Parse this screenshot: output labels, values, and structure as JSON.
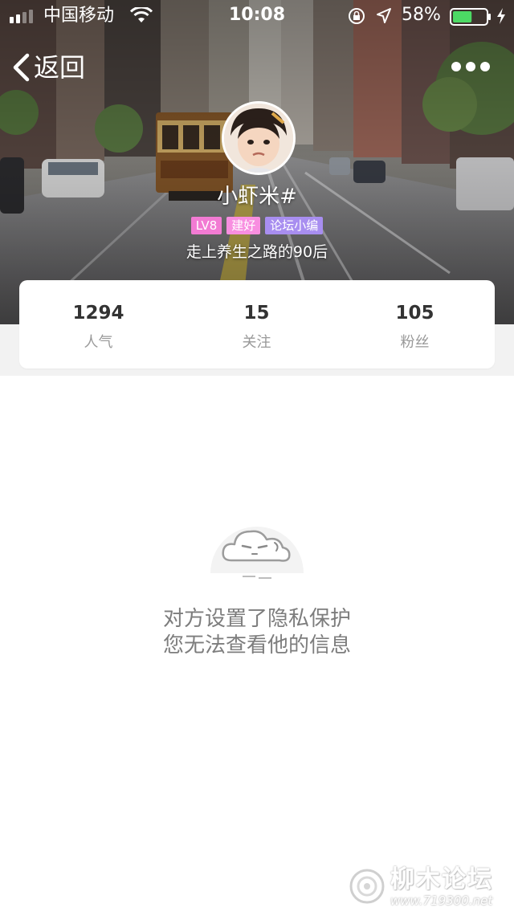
{
  "status_bar": {
    "carrier": "中国移动",
    "time": "10:08",
    "battery_percent": "58%",
    "battery_level": 0.58,
    "signal_bars": 2,
    "icons": [
      "signal-icon",
      "wifi-icon",
      "orientation-lock-icon",
      "location-icon",
      "battery-icon",
      "charging-bolt-icon"
    ]
  },
  "nav": {
    "back_label": "返回",
    "back_icon": "chevron-left-icon",
    "more_icon": "more-dots-icon"
  },
  "profile": {
    "username": "小虾米#",
    "tags": [
      {
        "label": "LV8",
        "color": "#f27bd3"
      },
      {
        "label": "建好",
        "color": "#f88ee0"
      },
      {
        "label": "论坛小编",
        "color": "#a88ef0"
      }
    ],
    "bio": "走上养生之路的90后"
  },
  "stats": [
    {
      "value": "1294",
      "label": "人气"
    },
    {
      "value": "15",
      "label": "关注"
    },
    {
      "value": "105",
      "label": "粉丝"
    }
  ],
  "empty_state": {
    "icon": "sleepy-cloud-icon",
    "line1": "对方设置了隐私保护",
    "line2": "您无法查看他的信息"
  },
  "watermark": {
    "logo_icon": "watermark-logo-icon",
    "text": "柳木论坛",
    "url": "www.719300.net"
  },
  "colors": {
    "stat_number": "#333333",
    "stat_label": "#999999",
    "empty_text": "#7d7d7d",
    "strip_bg": "#f2f2f2",
    "battery_fill": "#4cd964"
  }
}
